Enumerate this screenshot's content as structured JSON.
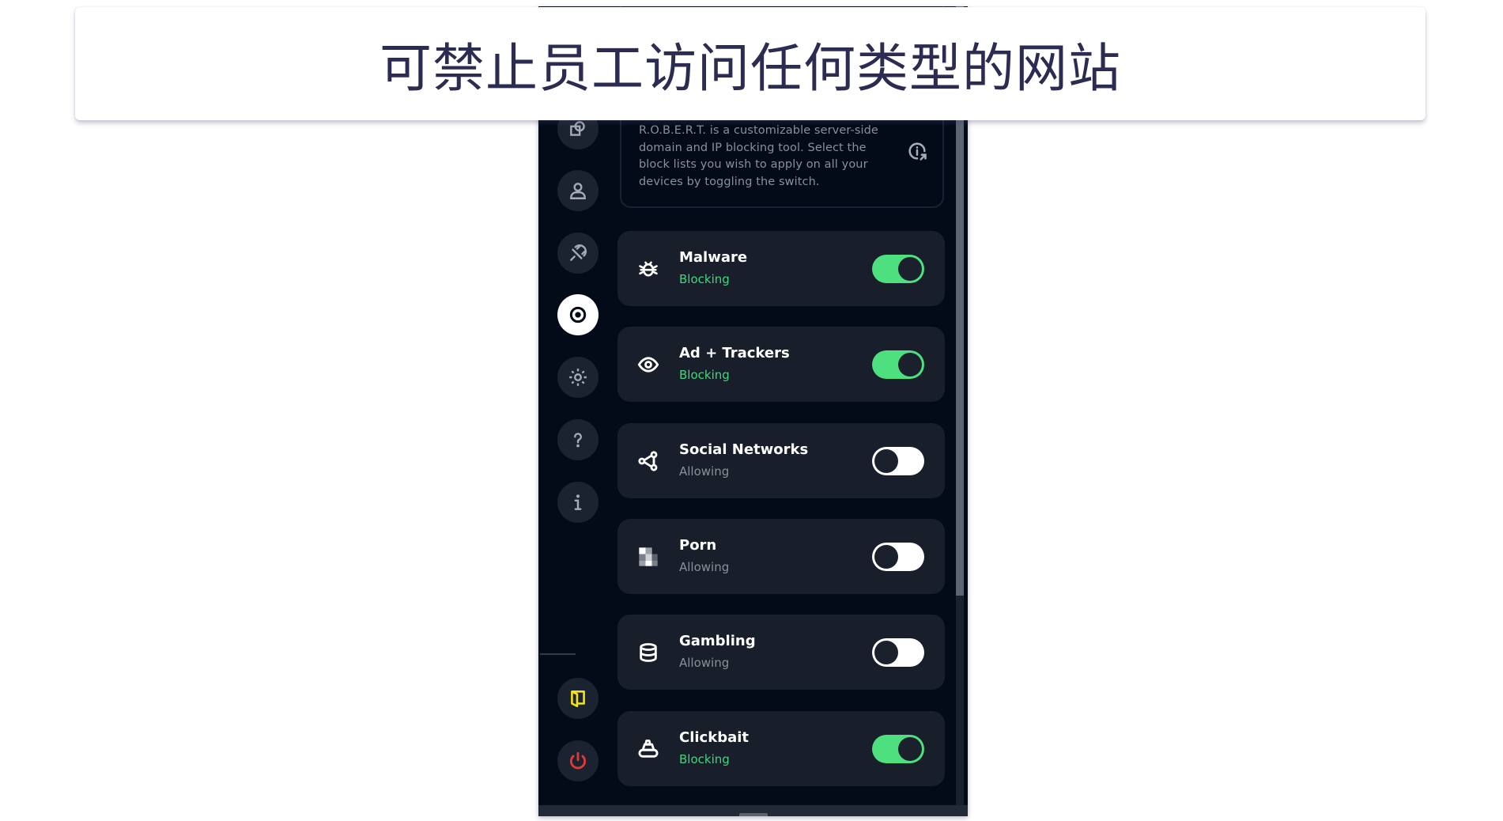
{
  "banner": {
    "title": "可禁止员工访问任何类型的网站"
  },
  "sidebar": {
    "items": [
      {
        "name": "devices",
        "icon": "overlapping-shapes-icon",
        "active": false
      },
      {
        "name": "account",
        "icon": "user-icon",
        "active": false
      },
      {
        "name": "connection",
        "icon": "plug-icon",
        "active": false
      },
      {
        "name": "blocker",
        "icon": "target-icon",
        "active": true
      },
      {
        "name": "settings",
        "icon": "gear-icon",
        "active": false
      },
      {
        "name": "help",
        "icon": "question-icon",
        "active": false
      },
      {
        "name": "about",
        "icon": "info-icon",
        "active": false
      }
    ],
    "bottom_items": [
      {
        "name": "exit-door",
        "icon": "door-icon",
        "color": "#f4e413"
      },
      {
        "name": "power",
        "icon": "power-icon",
        "color": "#e53935"
      }
    ]
  },
  "description": {
    "lines": [
      "R.O.B.E.R.T. is a customizable server-side",
      "domain and IP blocking tool. Select the",
      "block lists you wish to apply on all your",
      "devices by toggling the switch."
    ],
    "info_icon": "info-external-icon"
  },
  "blocklists": [
    {
      "title": "Malware",
      "status": "Blocking",
      "enabled": true,
      "icon": "bug-icon"
    },
    {
      "title": "Ad + Trackers",
      "status": "Blocking",
      "enabled": true,
      "icon": "eye-icon"
    },
    {
      "title": "Social Networks",
      "status": "Allowing",
      "enabled": false,
      "icon": "share-icon"
    },
    {
      "title": "Porn",
      "status": "Allowing",
      "enabled": false,
      "icon": "pixelated-icon"
    },
    {
      "title": "Gambling",
      "status": "Allowing",
      "enabled": false,
      "icon": "chips-stack-icon"
    },
    {
      "title": "Clickbait",
      "status": "Blocking",
      "enabled": true,
      "icon": "poop-icon"
    }
  ],
  "colors": {
    "accent_green": "#4ee07e",
    "status_blocking": "#3fd876",
    "status_allowing": "#8a9099",
    "background": "#030b18",
    "card": "#181f2b",
    "power_red": "#e53935",
    "door_yellow": "#f4e413"
  }
}
